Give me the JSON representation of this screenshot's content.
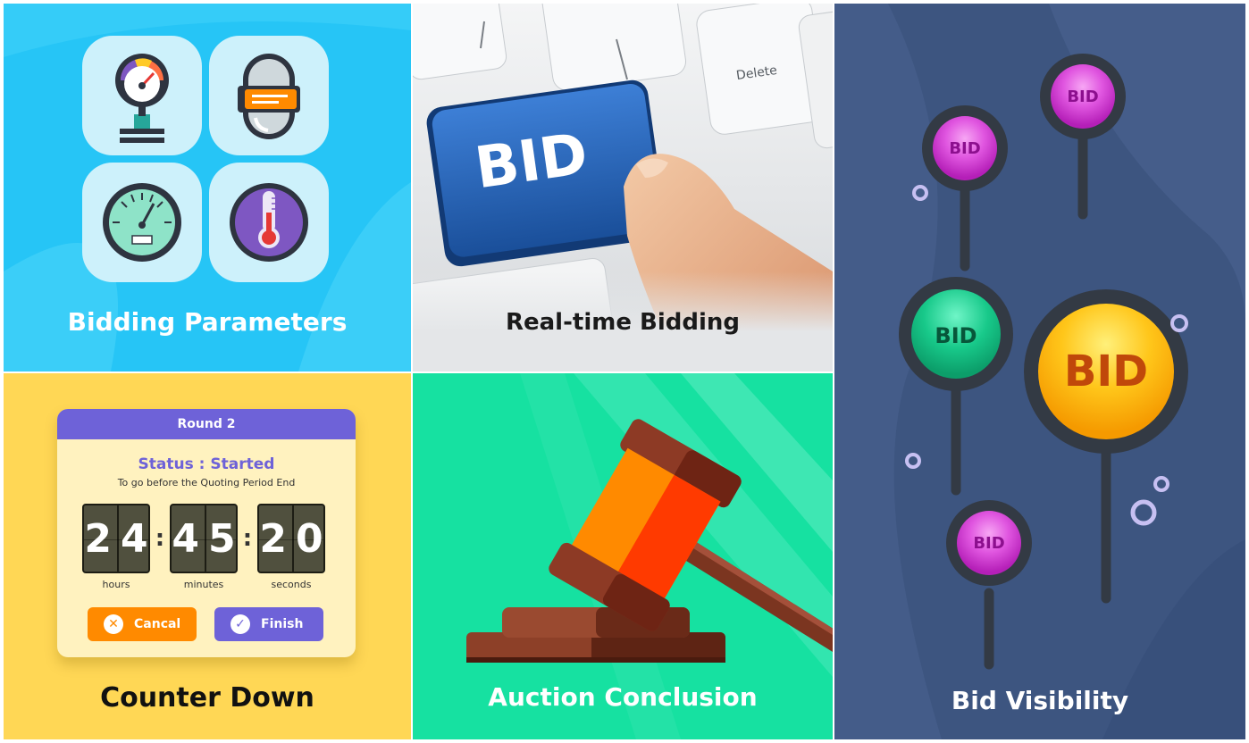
{
  "tiles": {
    "bidding_parameters": {
      "title": "Bidding Parameters"
    },
    "realtime_bidding": {
      "title": "Real-time Bidding",
      "keyboard": {
        "bid_key": "BID",
        "delete_key": "Delete"
      }
    },
    "bid_visibility": {
      "title": "Bid Visibility",
      "pins": [
        {
          "label": "BID",
          "color": "#d63ad6"
        },
        {
          "label": "BID",
          "color": "#d63ad6"
        },
        {
          "label": "BID",
          "color": "#14b07a"
        },
        {
          "label": "BID",
          "color": "#ffc21a"
        },
        {
          "label": "BID",
          "color": "#d63ad6"
        }
      ]
    },
    "counter_down": {
      "title": "Counter Down",
      "card": {
        "round": "Round 2",
        "status": "Status : Started",
        "subtitle": "To go before the Quoting Period End",
        "hours": "24",
        "minutes": "45",
        "seconds": "20",
        "hours_label": "hours",
        "minutes_label": "minutes",
        "seconds_label": "seconds",
        "cancel_label": "Cancal",
        "finish_label": "Finish"
      }
    },
    "auction_conclusion": {
      "title": "Auction Conclusion"
    }
  },
  "colors": {
    "sky_blue": "#26c5f6",
    "yellow": "#ffd755",
    "mint": "#16e1a1",
    "navy": "#3d5580",
    "purple": "#6e62d8",
    "orange": "#ff8a00"
  },
  "icons": [
    "pressure-gauge-icon",
    "capsule-icon",
    "speedometer-icon",
    "thermometer-icon",
    "gavel-icon",
    "cancel-icon",
    "check-icon"
  ]
}
